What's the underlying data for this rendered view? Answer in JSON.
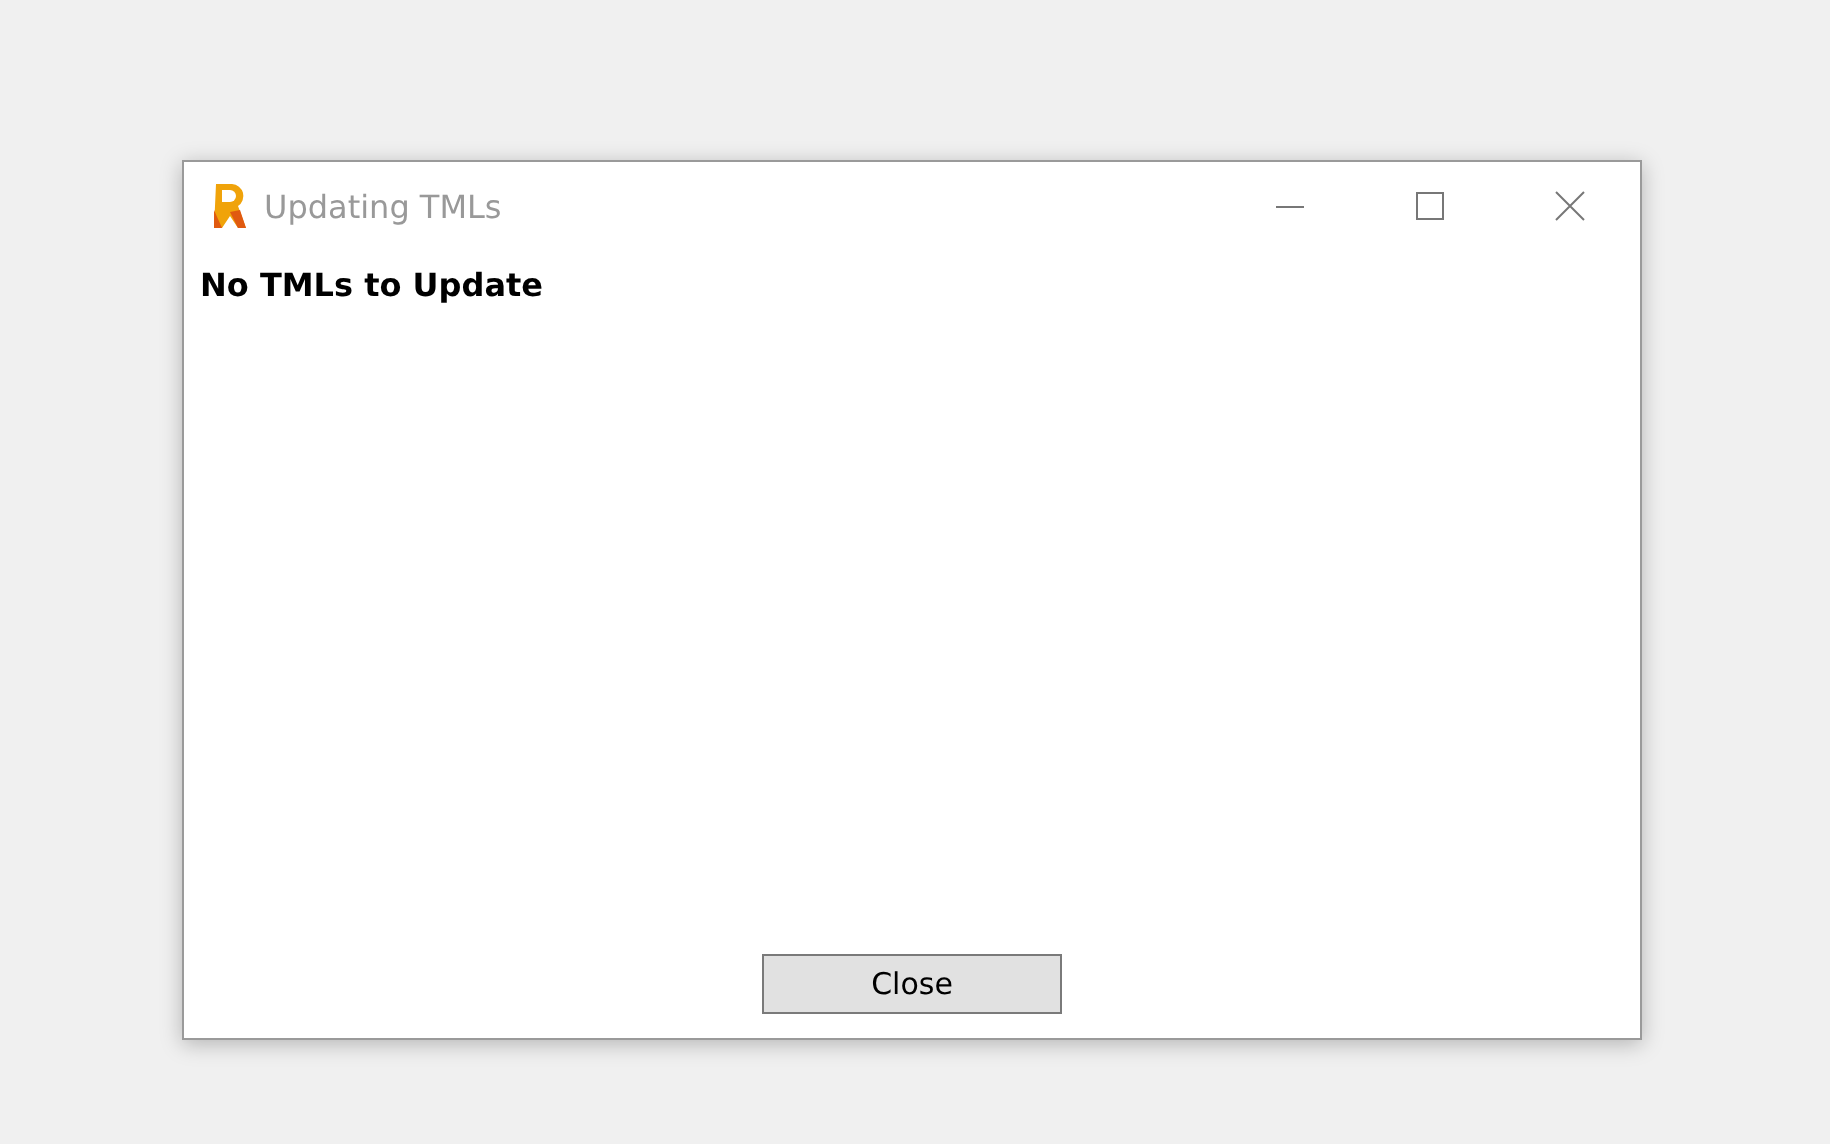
{
  "window": {
    "title": "Updating TMLs"
  },
  "message": "No TMLs to Update",
  "buttons": [
    "Close"
  ]
}
